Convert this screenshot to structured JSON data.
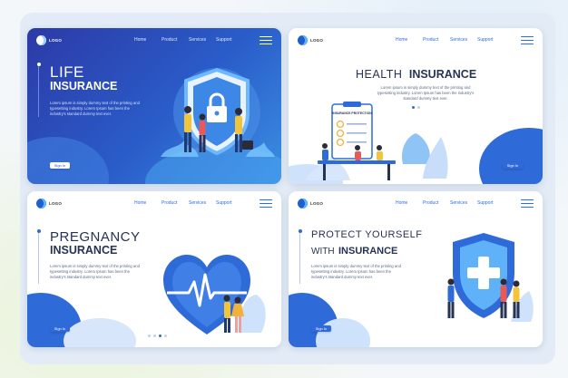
{
  "nav": {
    "home": "Home",
    "product": "Product",
    "services": "Services",
    "support": "Support"
  },
  "logo_text": "LOGO",
  "lorem": "Lorem ipsum is simply dummy text of the printing and typesetting industry. Lorem Ipsum has been the industry's standard dummy text ever.",
  "signin": "Sign In",
  "cards": {
    "life": {
      "line1": "LIFE",
      "line2": "INSURANCE"
    },
    "health": {
      "line1": "HEALTH",
      "line2": "INSURANCE",
      "doc_title": "INSURANCE PROTECTION"
    },
    "pregnancy": {
      "line1": "PREGNANCY",
      "line2": "INSURANCE"
    },
    "protect": {
      "line1": "PROTECT YOURSELF",
      "line2a": "WITH",
      "line2b": "INSURANCE"
    }
  },
  "colors": {
    "primary": "#2f6ad9",
    "dark_blue": "#2c3aa6",
    "light_blue": "#5fb2f7",
    "text_dark": "#263354"
  }
}
